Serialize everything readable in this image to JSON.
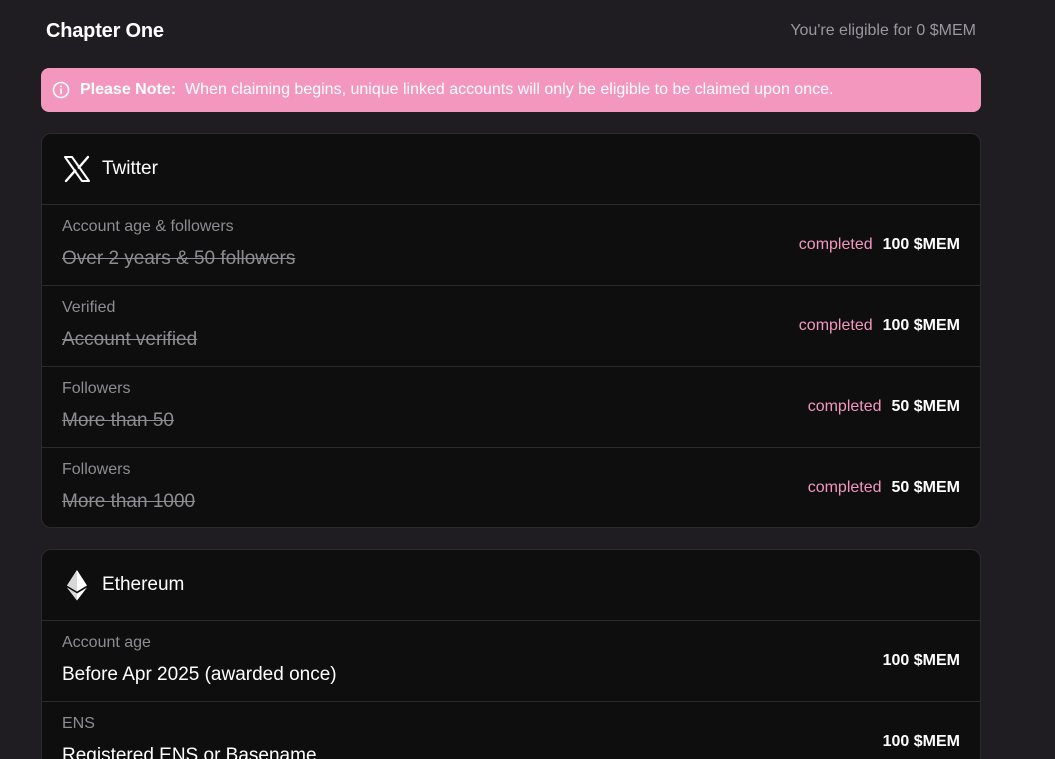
{
  "header": {
    "title": "Chapter One",
    "eligibility": "You're eligible for 0 $MEM"
  },
  "note": {
    "icon": "info-icon",
    "label": "Please Note:",
    "text": "When claiming begins, unique linked accounts will only be eligible to be claimed upon once."
  },
  "colors": {
    "background": "#1f1d22",
    "card": "#0e0e0e",
    "accent_pink": "#f497bf",
    "muted_text": "#8e8c93"
  },
  "twitter": {
    "icon": "x-logo-icon",
    "title": "Twitter",
    "rows": [
      {
        "label": "Account age & followers",
        "desc": "Over 2 years & 50 followers",
        "status": "completed",
        "reward": "100 $MEM"
      },
      {
        "label": "Verified",
        "desc": "Account verified",
        "status": "completed",
        "reward": "100 $MEM"
      },
      {
        "label": "Followers",
        "desc": "More than 50",
        "status": "completed",
        "reward": "50 $MEM"
      },
      {
        "label": "Followers",
        "desc": "More than 1000",
        "status": "completed",
        "reward": "50 $MEM"
      }
    ]
  },
  "ethereum": {
    "icon": "ethereum-logo-icon",
    "title": "Ethereum",
    "rows": [
      {
        "label": "Account age",
        "desc": "Before Apr 2025 (awarded once)",
        "reward": "100 $MEM"
      },
      {
        "label": "ENS",
        "desc": "Registered ENS or Basename",
        "reward": "100 $MEM"
      }
    ]
  }
}
